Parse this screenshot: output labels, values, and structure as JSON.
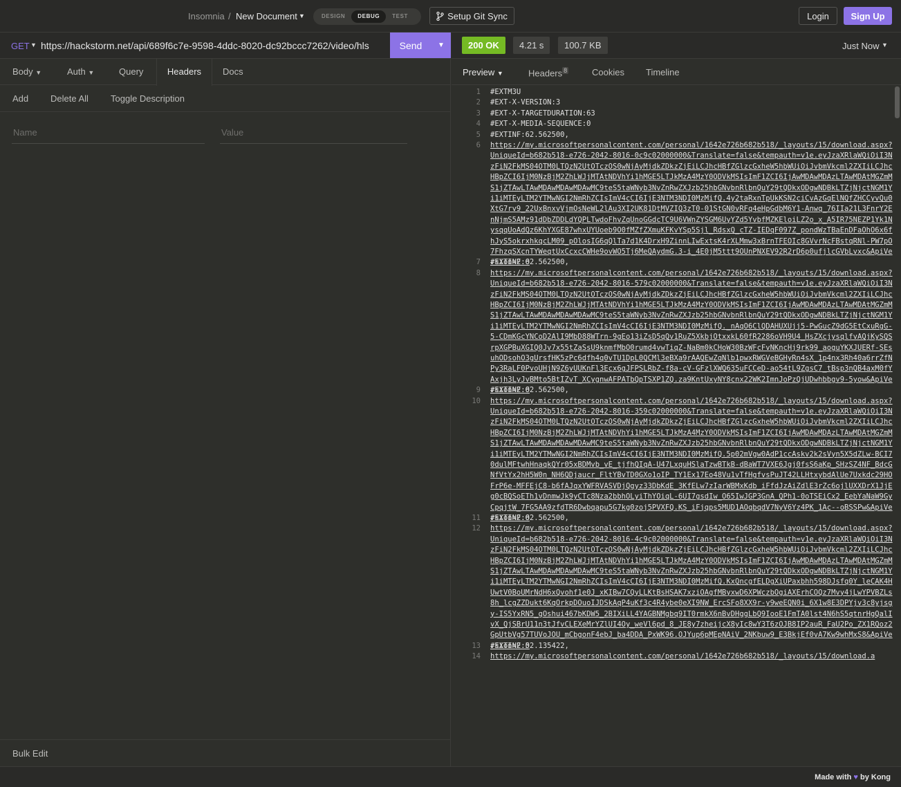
{
  "topbar": {
    "app_name": "Insomnia",
    "separator": "/",
    "document_name": "New Document",
    "modes": [
      "DESIGN",
      "DEBUG",
      "TEST"
    ],
    "active_mode": "DEBUG",
    "git_sync_label": "Setup Git Sync",
    "login_label": "Login",
    "signup_label": "Sign Up",
    "accent_color": "#8c73e6"
  },
  "request": {
    "method": "GET",
    "url": "https://hackstorm.net/api/689f6c7e-9598-4ddc-8020-dc92bccc7262/video/hls",
    "send_label": "Send",
    "tabs": {
      "body": "Body",
      "auth": "Auth",
      "query": "Query",
      "headers": "Headers",
      "docs": "Docs"
    },
    "active_tab": "Headers",
    "actions": {
      "add": "Add",
      "delete_all": "Delete All",
      "toggle_description": "Toggle Description"
    },
    "name_placeholder": "Name",
    "value_placeholder": "Value",
    "bulk_edit_label": "Bulk Edit"
  },
  "response": {
    "status": "200 OK",
    "status_color": "#75ba24",
    "time": "4.21 s",
    "size": "100.7 KB",
    "history": "Just Now",
    "tabs": {
      "preview": "Preview",
      "headers": "Headers",
      "headers_count": "8",
      "cookies": "Cookies",
      "timeline": "Timeline"
    },
    "active_tab": "Preview",
    "lines": [
      {
        "n": "1",
        "text": "#EXTM3U",
        "link": false
      },
      {
        "n": "2",
        "text": "#EXT-X-VERSION:3",
        "link": false
      },
      {
        "n": "3",
        "text": "#EXT-X-TARGETDURATION:63",
        "link": false
      },
      {
        "n": "4",
        "text": "#EXT-X-MEDIA-SEQUENCE:0",
        "link": false
      },
      {
        "n": "5",
        "text": "#EXTINF:62.562500,",
        "link": false
      },
      {
        "n": "6",
        "text": "https://my.microsoftpersonalcontent.com/personal/1642e726b682b518/_layouts/15/download.aspx?UniqueId=b682b518-e726-2042-8016-0c9c02000000&Translate=false&tempauth=v1e.eyJzaXRlaWQiOiI3NzFiN2FkMS04OTM0LTQzN2UtOTczOS0wNjAyMjdkZDkzZjEiLCJhcHBfZGlzcGxheW5hbWUiOiJvbmVkcml2ZXIiLCJhcHBpZCI6IjM0NzBjM2ZhLWJjMTAtNDVhYi1hMGE5LTJkMzA4MzY0ODVkMSIsImF1ZCI6IjAwMDAwMDAzLTAwMDAtMGZmMS1jZTAwLTAwMDAwMDAwMDAwMC9teS5taWNyb3NvZnRwZXJzb25hbGNvbnRlbnQuY29tQDkxODgwNDBkLTZjNjctNGM1Yi1iMTEyLTM2YTMwNGI2NmRhZCIsImV4cCI6IjE3NTM3NDI0MzMifQ.4y2taRxnTpUkKSN2ciCvAzGqElNQfZHCCyvQu0XtG7rv9_22UxBnxvVjmOsNeWL2lAu3XI2UK81DtMVZIQ3zT0-01StGN0vRFq4eHpGdbM6Y1-Anwq_76IIa21L3FnrY2EnNjmS5AMz91dDbZDDLdYQPLTwdoFhvZqUnoGGdcTC9U6VWnZYSGM6UyYZd5YvbfMZKEloiLZ2o_x_A5IR75NEZP1Yk1NysqqUoAdQz6KhYXGE87whxUYUoeb9O0fMZfZXmuKFKvYSp5Sjl_RdsxQ_cTZ-IEDqF097Z_pondWzTBaEnDFaOhO6x6fhJyS5okrxhkqcLM09_pOlosIG6qQlTa7d1K4DrxH9ZinnLIwExtsK4rXLMmw3xBrnTFEOIc8GVvrNcFBstqRNl-PW7pO7FhzqSXcnTYWeqtUxCcxcCWHe9ovWO5Tj6MeQAydmG.3-i_4E0jM5ttt9OUnPNXEV92R2rD6p0ufjlcGVbLvxc&ApiVersion=2.0",
        "link": true
      },
      {
        "n": "7",
        "text": "#EXTINF:62.562500,",
        "link": false
      },
      {
        "n": "8",
        "text": "https://my.microsoftpersonalcontent.com/personal/1642e726b682b518/_layouts/15/download.aspx?UniqueId=b682b518-e726-2042-8016-579c02000000&Translate=false&tempauth=v1e.eyJzaXRlaWQiOiI3NzFiN2FkMS04OTM0LTQzN2UtOTczOS0wNjAyMjdkZDkzZjEiLCJhcHBfZGlzcGxheW5hbWUiOiJvbmVkcml2ZXIiLCJhcHBpZCI6IjM0NzBjM2ZhLWJjMTAtNDVhYi1hMGE5LTJkMzA4MzY0ODVkMSIsImF1ZCI6IjAwMDAwMDAzLTAwMDAtMGZmMS1jZTAwLTAwMDAwMDAwMDAwMC9teS5taWNyb3NvZnRwZXJzb25hbGNvbnRlbnQuY29tQDkxODgwNDBkLTZjNjctNGM1Yi1iMTEyLTM2YTMwNGI2NmRhZCIsImV4cCI6IjE3NTM3NDI0MzMifQ._nAqO6ClQDAHUXUjj5-PwGucZ9dG5EtCxuRgG-5-CDmKGcYNCoD2AlI9MbD88WTrn-9gEo13iZsD5qQv1RuZ5XkbjOtxxkL60fR2286oVH9U4_HsZXcjysqlfvAQjKySQSrpXGPBuXGIQ0Jv7x55tZaSsU9knmfMbO0rumd4vwTiqZ-NaBm0kCHoW30BzWFcFvNKncHj9rk99_aoguYKXJUERf-SEsuhODsohO3gUrsfHK5zPc6dfh4q0vTU1DpL0QCMl3eBXa9rAAQEwZqNlb1pwxRWGVeBGHyRn4sX_1p4nx3Rh40a6rrZfNPy3RaLF0PvoUHjN9Z6yUUKnFl3Ecx6gJFPSLRbZ-f8a-cV-GFzlXWQ635uFCCeD-ao54tL9ZgsC7_tBsp3nQB4axM0fYAxjh3LyJvBMto5BtIZvT_XCygnwAFPATbQpTSXP1ZQ.za9KntUxyNY8cnx22WK2ImnJoPzQjUDwhbbgv9-5yow&ApiVersion=2.0",
        "link": true
      },
      {
        "n": "9",
        "text": "#EXTINF:62.562500,",
        "link": false
      },
      {
        "n": "10",
        "text": "https://my.microsoftpersonalcontent.com/personal/1642e726b682b518/_layouts/15/download.aspx?UniqueId=b682b518-e726-2042-8016-359c02000000&Translate=false&tempauth=v1e.eyJzaXRlaWQiOiI3NzFiN2FkMS04OTM0LTQzN2UtOTczOS0wNjAyMjdkZDkzZjEiLCJhcHBfZGlzcGxheW5hbWUiOiJvbmVkcml2ZXIiLCJhcHBpZCI6IjM0NzBjM2ZhLWJjMTAtNDVhYi1hMGE5LTJkMzA4MzY0ODVkMSIsImF1ZCI6IjAwMDAwMDAzLTAwMDAtMGZmMS1jZTAwLTAwMDAwMDAwMDAwMC9teS5taWNyb3NvZnRwZXJzb25hbGNvbnRlbnQuY29tQDkxODgwNDBkLTZjNjctNGM1Yi1iMTEyLTM2YTMwNGI2NmRhZCIsImV4cCI6IjE3NTM3NDI0MzMifQ.5p02mVgw0AdP1ccAskv2k2sVyn5X5dZLw-BCI70dulMFtwhHnaqkQYr05xBDMvb_vE_tjfhQIqA-U47LxquHSlaTzwBTkB-dBaWT7VXE6Jgj0fsS6aKp_SHzSZ4NF_BdcGNfVtYx2hH5W0n_NH6QDjaucr_FltYBvTD0GXo1oIP_TY1Ex17Eo48Vu1vTfHgfvsPuJT42LLHtxybdAlUe7Uxkdc29HOFrP6e-MFFEjC8-b6fAJqxYWFRVASVDjQgyz33DbKdE_3KfELw7zIarWBMxKdb_iFfdJzAiZdlE3rZc6ojlUXXDrX1JjEg0cBQSoETh1vDnmwJk9yCTc8Nza2bbhOLyiThYOiqL-6UI7gsdIw_O65IwJGP3GnA_QPh1-0oTSEiCx2_EebYaNaW9GyCpqjtW_7FG5AA9zfdTR6Dwbqapu5G7kg0zoj5PVXFQ.KS_iFjqps5MUD1AOqbqdV7NyV6Yz4PK_1Ac--oBSSPw&ApiVersion=2.0",
        "link": true
      },
      {
        "n": "11",
        "text": "#EXTINF:62.562500,",
        "link": false
      },
      {
        "n": "12",
        "text": "https://my.microsoftpersonalcontent.com/personal/1642e726b682b518/_layouts/15/download.aspx?UniqueId=b682b518-e726-2042-8016-4c9c02000000&Translate=false&tempauth=v1e.eyJzaXRlaWQiOiI3NzFiN2FkMS04OTM0LTQzN2UtOTczOS0wNjAyMjdkZDkzZjEiLCJhcHBfZGlzcGxheW5hbWUiOiJvbmVkcml2ZXIiLCJhcHBpZCI6IjM0NzBjM2ZhLWJjMTAtNDVhYi1hMGE5LTJkMzA4MzY0ODVkMSIsImF1ZCI6IjAwMDAwMDAzLTAwMDAtMGZmMS1jZTAwLTAwMDAwMDAwMDAwMC9teS5taWNyb3NvZnRwZXJzb25hbGNvbnRlbnQuY29tQDkxODgwNDBkLTZjNjctNGM1Yi1iMTEyLTM2YTMwNGI2NmRhZCIsImV4cCI6IjE3NTM3NDI0MzMifQ.KxQncgfELDgXiUPaxbhh598DJsfq0Y_leCAK4HUwtV0BoUMrNdH6xQvohf1e0J_xKIBw7CQyLLKtBsHSAK7xziOAgfMByxwD6XPWczbOgiAXErhCOQz7Mvy4jLwYPVBZLs8h_lcgZZDukt6KqOrkpDOuoIJDSkAqP4uKf3c4R4ybe0eXI9NW_ErcSFo8XX9r-y9weEQN0i_6X1w8E3DPYjv3c8yjsgy-IS5YxRN5_gOshui467bKDW5_2BIXiLL4YAGBNMgbq9IT0rmkX6nBvDHggLbQ9IooE1FmTA0lst4N6hS5qtnrHgQalIvX_QjSBrU11n3tJfvCLEXeMrYZlUI4Oy_weVl6pd_8_JE8y7zheijcX8yIc8wY3T6zOJB8IP2auR_FaU2Po_ZX1RQoz2GpUtbVg57TUVoJOU_mCbgonF4ebJ_ba4DDA_PxWK96.OJYup6pMEpNAiV_2NKbuw9_E3BkjEf0vA7Kw9whMxS8&ApiVersion=2.0",
        "link": true
      },
      {
        "n": "13",
        "text": "#EXTINF:52.135422,",
        "link": false
      },
      {
        "n": "14",
        "text": "https://my.microsoftpersonalcontent.com/personal/1642e726b682b518/_layouts/15/download.a",
        "link": true
      }
    ]
  },
  "footer": {
    "made_with": "Made with",
    "heart": "♥",
    "by": "by Kong"
  }
}
